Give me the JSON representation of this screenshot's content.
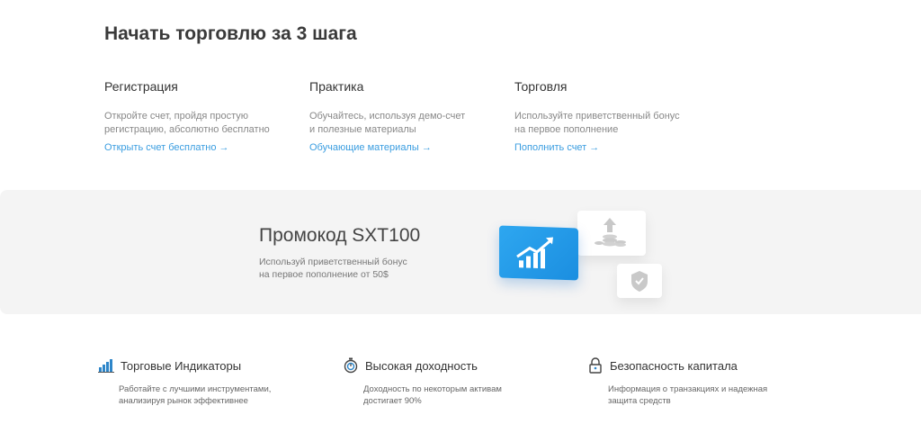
{
  "page_title": "Начать торговлю за 3 шага",
  "steps": [
    {
      "title": "Регистрация",
      "desc_line1": "Откройте счет, пройдя простую",
      "desc_line2": "регистрацию, абсолютно бесплатно",
      "link": "Открыть счет бесплатно →"
    },
    {
      "title": "Практика",
      "desc_line1": "Обучайтесь, используя демо-счет",
      "desc_line2": "и полезные материалы",
      "link": "Обучающие материалы →"
    },
    {
      "title": "Торговля",
      "desc_line1": "Используйте приветственный бонус",
      "desc_line2": "на первое пополнение",
      "link": "Пополнить счет →"
    }
  ],
  "promo": {
    "title": "Промокод SXT100",
    "desc_line1": "Используй приветственный бонус",
    "desc_line2": "на первое пополнение от 50$"
  },
  "features": [
    {
      "icon": "bar-chart-icon",
      "title": "Торговые Индикаторы",
      "desc_line1": "Работайте с лучшими инструментами,",
      "desc_line2": "анализируя рынок эффективнее"
    },
    {
      "icon": "stopwatch-icon",
      "title": "Высокая доходность",
      "desc_line1": "Доходность по некоторым активам",
      "desc_line2": "достигает 90%"
    },
    {
      "icon": "lock-icon",
      "title": "Безопасность капитала",
      "desc_line1": "Информация о транзакциях и надежная",
      "desc_line2": "защита средств"
    }
  ],
  "colors": {
    "link": "#3a9de0",
    "promo_bg": "#f4f4f4",
    "accent_blue": "#2ea7f0"
  }
}
